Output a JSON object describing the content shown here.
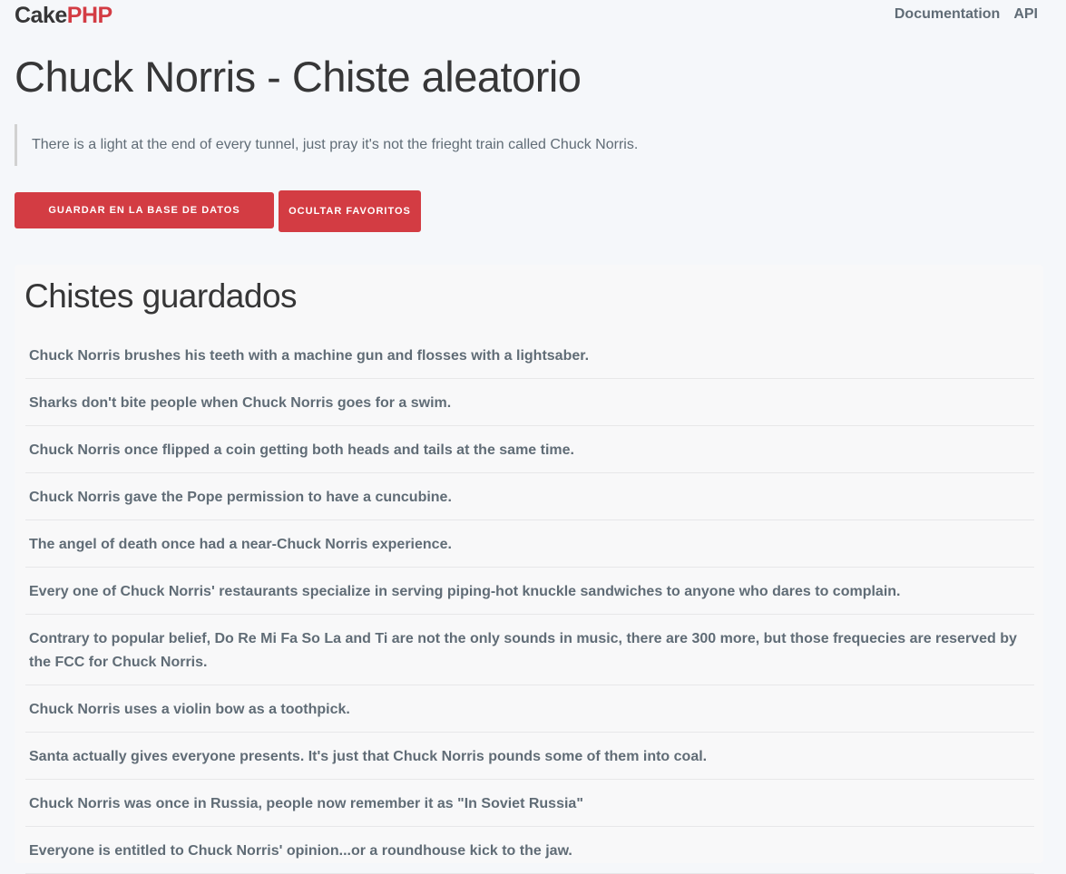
{
  "nav": {
    "logo_part1": "Cake",
    "logo_part2": "PHP",
    "links": [
      "Documentation",
      "API"
    ]
  },
  "page": {
    "title": "Chuck Norris - Chiste aleatorio",
    "joke": "There is a light at the end of every tunnel, just pray it's not the frieght train called Chuck Norris."
  },
  "actions": {
    "save_label": "Guardar en la base de datos",
    "hide_label": "Ocultar favoritos"
  },
  "saved": {
    "title": "Chistes guardados",
    "items": [
      "Chuck Norris brushes his teeth with a machine gun and flosses with a lightsaber.",
      "Sharks don't bite people when Chuck Norris goes for a swim.",
      "Chuck Norris once flipped a coin getting both heads and tails at the same time.",
      "Chuck Norris gave the Pope permission to have a cuncubine.",
      "The angel of death once had a near-Chuck Norris experience.",
      "Every one of Chuck Norris' restaurants specialize in serving piping-hot knuckle sandwiches to anyone who dares to complain.",
      "Contrary to popular belief, Do Re Mi Fa So La and Ti are not the only sounds in music, there are 300 more, but those frequecies are reserved by the FCC for Chuck Norris.",
      "Chuck Norris uses a violin bow as a toothpick.",
      "Santa actually gives everyone presents. It's just that Chuck Norris pounds some of them into coal.",
      "Chuck Norris was once in Russia, people now remember it as \"In Soviet Russia\"",
      "Everyone is entitled to Chuck Norris' opinion...or a roundhouse kick to the jaw."
    ]
  },
  "colors": {
    "accent": "#d33c43",
    "background": "#f5f7fa",
    "text": "#363637",
    "muted_text": "#606c76"
  }
}
